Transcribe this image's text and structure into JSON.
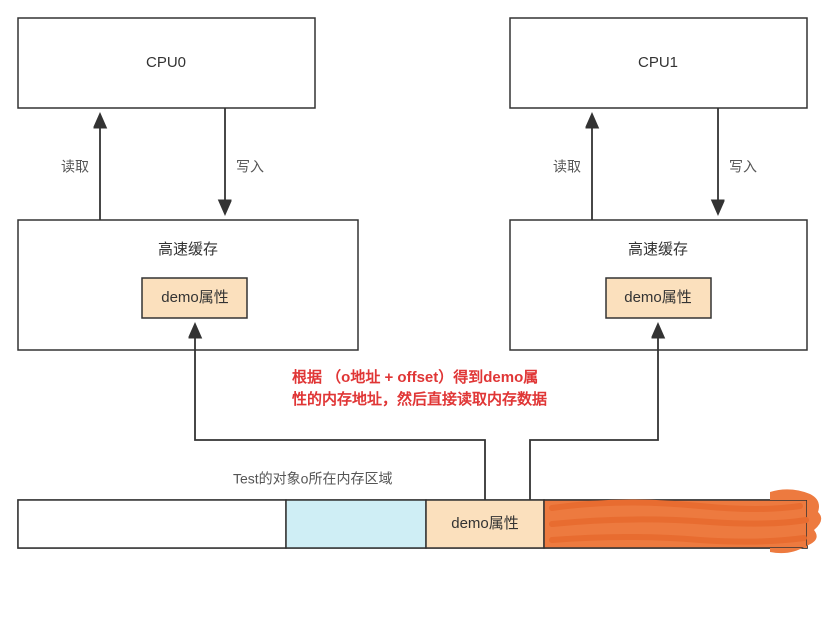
{
  "cpu0": {
    "label": "CPU0"
  },
  "cpu1": {
    "label": "CPU1"
  },
  "cache0": {
    "label": "高速缓存",
    "demo": "demo属性"
  },
  "cache1": {
    "label": "高速缓存",
    "demo": "demo属性"
  },
  "arrows": {
    "read": "读取",
    "write": "写入"
  },
  "note": {
    "line1": "根据 （o地址 + offset）得到demo属",
    "line2": "性的内存地址，然后直接读取内存数据"
  },
  "memory": {
    "caption": "Test的对象o所在内存区域",
    "demo": "demo属性"
  }
}
